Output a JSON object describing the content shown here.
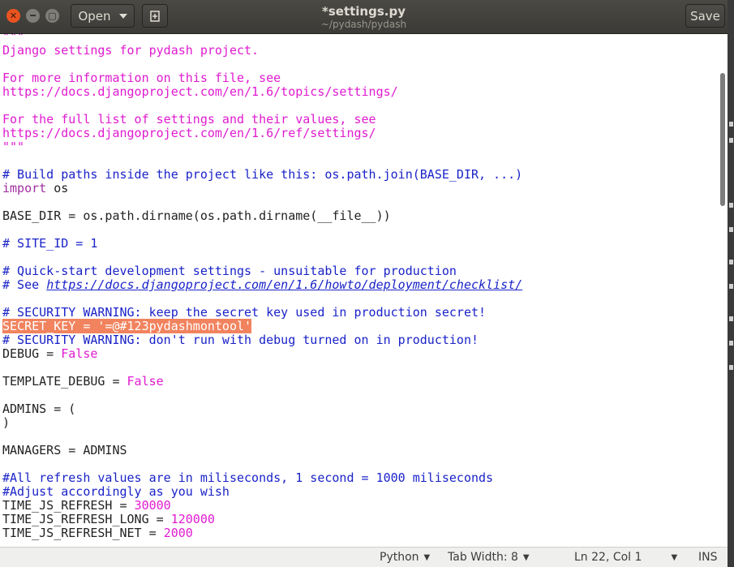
{
  "window": {
    "title": "*settings.py",
    "subtitle": "~/pydash/pydash",
    "open_label": "Open",
    "save_label": "Save"
  },
  "code_lines": [
    [
      {
        "t": "\"\"\"",
        "c": "str"
      }
    ],
    [
      {
        "t": "Django settings for pydash project.",
        "c": "str"
      }
    ],
    [],
    [
      {
        "t": "For more information on this file, see",
        "c": "str"
      }
    ],
    [
      {
        "t": "https://docs.djangoproject.com/en/1.6/topics/settings/",
        "c": "str"
      }
    ],
    [],
    [
      {
        "t": "For the full list of settings and their values, see",
        "c": "str"
      }
    ],
    [
      {
        "t": "https://docs.djangoproject.com/en/1.6/ref/settings/",
        "c": "str"
      }
    ],
    [
      {
        "t": "\"\"\"",
        "c": "str"
      }
    ],
    [],
    [
      {
        "t": "# Build paths inside the project like this: os.path.join(BASE_DIR, ...)",
        "c": "com"
      }
    ],
    [
      {
        "t": "import",
        "c": "kw"
      },
      {
        "t": " os",
        "c": ""
      }
    ],
    [],
    [
      {
        "t": "BASE_DIR = os.path.dirname(os.path.dirname(__file__))",
        "c": ""
      }
    ],
    [],
    [
      {
        "t": "# SITE_ID = 1",
        "c": "com"
      }
    ],
    [],
    [
      {
        "t": "# Quick-start development settings - unsuitable for production",
        "c": "com"
      }
    ],
    [
      {
        "t": "# See ",
        "c": "com"
      },
      {
        "t": "https://docs.djangoproject.com/en/1.6/howto/deployment/checklist/",
        "c": "com link"
      }
    ],
    [],
    [
      {
        "t": "# SECURITY WARNING: keep the secret key used in production secret!",
        "c": "com"
      }
    ],
    [
      {
        "t": "SECRET_KEY = '=@#123pydashmontool'",
        "c": "hl"
      }
    ],
    [
      {
        "t": "# SECURITY WARNING: don't run with debug turned on in production!",
        "c": "com"
      }
    ],
    [
      {
        "t": "DEBUG = ",
        "c": ""
      },
      {
        "t": "False",
        "c": "bool"
      }
    ],
    [],
    [
      {
        "t": "TEMPLATE_DEBUG = ",
        "c": ""
      },
      {
        "t": "False",
        "c": "bool"
      }
    ],
    [],
    [
      {
        "t": "ADMINS = (",
        "c": ""
      }
    ],
    [
      {
        "t": ")",
        "c": ""
      }
    ],
    [],
    [
      {
        "t": "MANAGERS = ADMINS",
        "c": ""
      }
    ],
    [],
    [
      {
        "t": "#All refresh values are in miliseconds, 1 second = 1000 miliseconds",
        "c": "com"
      }
    ],
    [
      {
        "t": "#Adjust accordingly as you wish",
        "c": "com"
      }
    ],
    [
      {
        "t": "TIME_JS_REFRESH = ",
        "c": ""
      },
      {
        "t": "30000",
        "c": "num"
      }
    ],
    [
      {
        "t": "TIME_JS_REFRESH_LONG = ",
        "c": ""
      },
      {
        "t": "120000",
        "c": "num"
      }
    ],
    [
      {
        "t": "TIME_JS_REFRESH_NET = ",
        "c": ""
      },
      {
        "t": "2000",
        "c": "num"
      }
    ]
  ],
  "status": {
    "language": "Python",
    "tab_width": "Tab Width: 8",
    "position": "Ln 22, Col 1",
    "mode": "INS"
  }
}
